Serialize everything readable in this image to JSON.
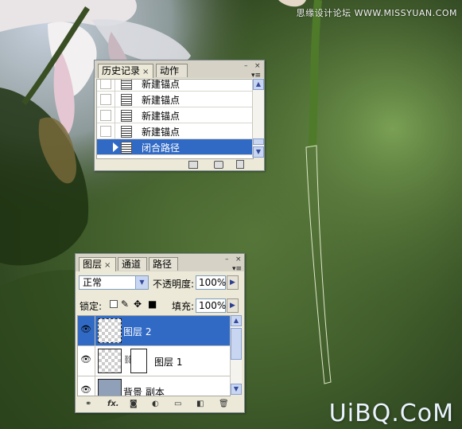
{
  "watermark_top": "思缘设计论坛  WWW.MISSYUAN.COM",
  "watermark_bottom": "UiBQ.CoM",
  "history_panel": {
    "tabs": [
      {
        "label": "历史记录",
        "close": "×",
        "active": true
      },
      {
        "label": "动作",
        "active": false
      }
    ],
    "window_controls": {
      "minimize": "–",
      "close": "×"
    },
    "menu_glyph": "▾≡",
    "items": [
      {
        "label": "新建锚点",
        "selected": false
      },
      {
        "label": "新建锚点",
        "selected": false
      },
      {
        "label": "新建锚点",
        "selected": false
      },
      {
        "label": "新建锚点",
        "selected": false
      },
      {
        "label": "闭合路径",
        "selected": true
      }
    ],
    "footer_icons": [
      "new-document-from-state-icon",
      "new-snapshot-icon",
      "trash-icon"
    ]
  },
  "layers_panel": {
    "tabs": [
      {
        "label": "图层",
        "close": "×",
        "active": true
      },
      {
        "label": "通道",
        "active": false
      },
      {
        "label": "路径",
        "active": false
      }
    ],
    "window_controls": {
      "minimize": "–",
      "close": "×"
    },
    "menu_glyph": "▾≡",
    "blend_mode": "正常",
    "opacity_label": "不透明度:",
    "opacity_value": "100%",
    "lock_label": "锁定:",
    "fill_label": "填充:",
    "fill_value": "100%",
    "layers": [
      {
        "name": "图层 2",
        "visible": true,
        "selected": true,
        "has_mask": false
      },
      {
        "name": "图层 1",
        "visible": true,
        "selected": false,
        "has_mask": true
      },
      {
        "name": "背景 副本",
        "visible": true,
        "selected": false,
        "has_mask": false
      }
    ],
    "footer_icons": [
      "link-layers-icon",
      "fx-icon",
      "add-mask-icon",
      "adjustment-layer-icon",
      "new-group-icon",
      "new-layer-icon",
      "trash-icon"
    ],
    "footer_fx_text": "fx."
  },
  "colors": {
    "selection": "#316ac5",
    "panel_bg": "#ece9d8"
  }
}
